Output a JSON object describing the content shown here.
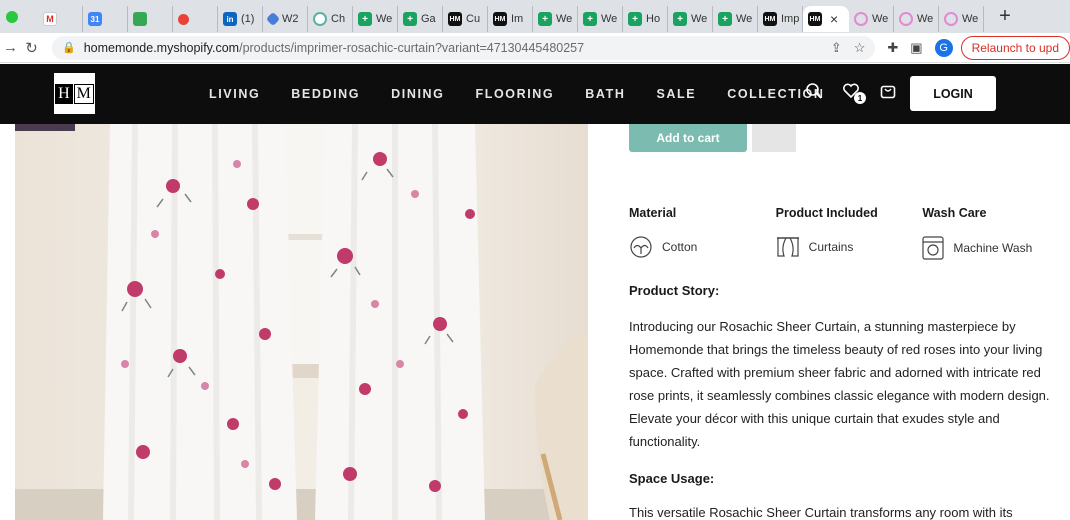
{
  "browser": {
    "tabs": [
      {
        "icon": "gmail",
        "label": ""
      },
      {
        "icon": "calendar",
        "label": ""
      },
      {
        "icon": "drive",
        "label": ""
      },
      {
        "icon": "record",
        "label": ""
      },
      {
        "icon": "linkedin",
        "label": "(1)"
      },
      {
        "icon": "diamond",
        "label": "W2"
      },
      {
        "icon": "chatgpt",
        "label": "Ch"
      },
      {
        "icon": "plus-green",
        "label": "We"
      },
      {
        "icon": "plus-green",
        "label": "Ga"
      },
      {
        "icon": "hm",
        "label": "Cu"
      },
      {
        "icon": "hm",
        "label": "Im"
      },
      {
        "icon": "plus-green",
        "label": "We"
      },
      {
        "icon": "plus-green",
        "label": "We"
      },
      {
        "icon": "plus-green",
        "label": "Ho"
      },
      {
        "icon": "plus-green",
        "label": "We"
      },
      {
        "icon": "plus-green",
        "label": "We"
      },
      {
        "icon": "hm",
        "label": "Imp"
      },
      {
        "icon": "hm",
        "label": "",
        "active": true
      },
      {
        "icon": "flower",
        "label": "We"
      },
      {
        "icon": "flower",
        "label": "We"
      },
      {
        "icon": "flower",
        "label": "We"
      }
    ],
    "url_host": "homemonde.myshopify.com",
    "url_path": "/products/imprimer-rosachic-curtain?variant=47130445480257",
    "profile_initial": "G",
    "relaunch_label": "Relaunch to upd"
  },
  "site": {
    "logo_letters": [
      "H",
      "M"
    ],
    "nav": [
      "LIVING",
      "BEDDING",
      "DINING",
      "FLOORING",
      "BATH",
      "SALE",
      "COLLECTION"
    ],
    "wishlist_count": "1",
    "login_label": "LOGIN"
  },
  "product": {
    "add_to_cart": "Add to cart",
    "specs": [
      {
        "heading": "Material",
        "value": "Cotton",
        "icon": "cotton-icon"
      },
      {
        "heading": "Product Included",
        "value": "Curtains",
        "icon": "curtain-icon"
      },
      {
        "heading": "Wash Care",
        "value": "Machine Wash",
        "icon": "washing-machine-icon"
      }
    ],
    "story_title": "Product Story:",
    "story_text": "Introducing our Rosachic Sheer Curtain, a stunning masterpiece by Homemonde that brings the timeless beauty of red roses into your living space. Crafted with premium sheer fabric and adorned with intricate red rose prints, it seamlessly combines classic elegance with modern design. Elevate your décor with this unique curtain that exudes style and functionality.",
    "usage_title": "Space Usage:",
    "usage_text": "This versatile Rosachic Sheer Curtain transforms any room with its"
  },
  "colors": {
    "header_bg": "#0d0d0d",
    "add_to_cart_bg": "#7bbbb0",
    "relaunch": "#d93025"
  }
}
